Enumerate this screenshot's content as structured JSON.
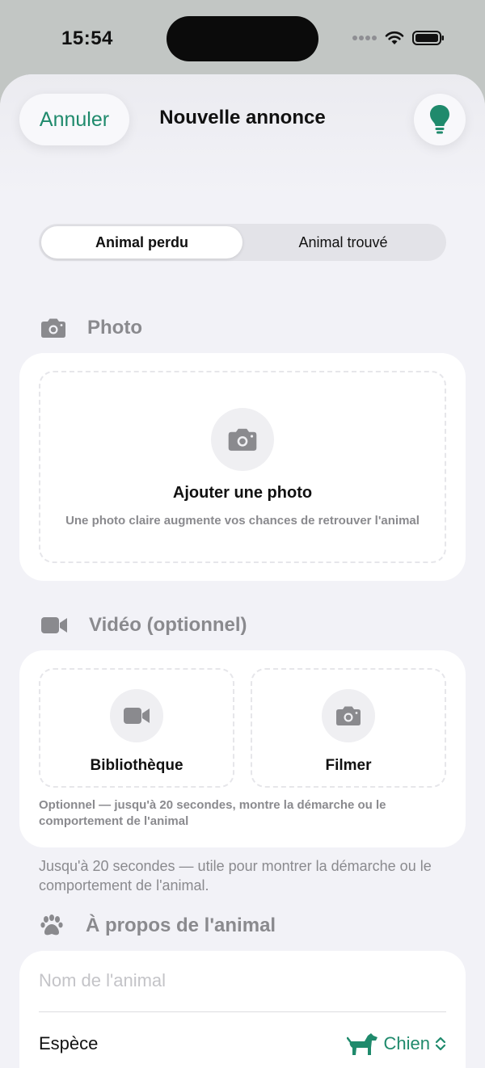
{
  "status_bar": {
    "time": "15:54"
  },
  "nav": {
    "cancel_label": "Annuler",
    "title": "Nouvelle annonce"
  },
  "segment": {
    "options": [
      "Animal perdu",
      "Animal trouvé"
    ],
    "selected": "Animal perdu"
  },
  "photo_section": {
    "header": "Photo",
    "add_title": "Ajouter une photo",
    "add_subtitle": "Une photo claire augmente vos chances de retrouver l'animal"
  },
  "video_section": {
    "header": "Vidéo (optionnel)",
    "library_label": "Bibliothèque",
    "record_label": "Filmer",
    "note": "Optionnel — jusqu'à 20 secondes, montre la démarche ou le comportement de l'animal",
    "helper": "Jusqu'à 20 secondes — utile pour montrer la démarche ou le comportement de l'animal."
  },
  "about_section": {
    "header": "À propos de l'animal",
    "name_placeholder": "Nom de l'animal",
    "species_label": "Espèce",
    "species_value": "Chien"
  },
  "icons": {
    "accent": "#1f8a6c",
    "tip": "lightbulb-icon",
    "photo": "camera-icon",
    "video": "video-camera-icon",
    "about": "paw-icon",
    "species": "dog-icon"
  }
}
